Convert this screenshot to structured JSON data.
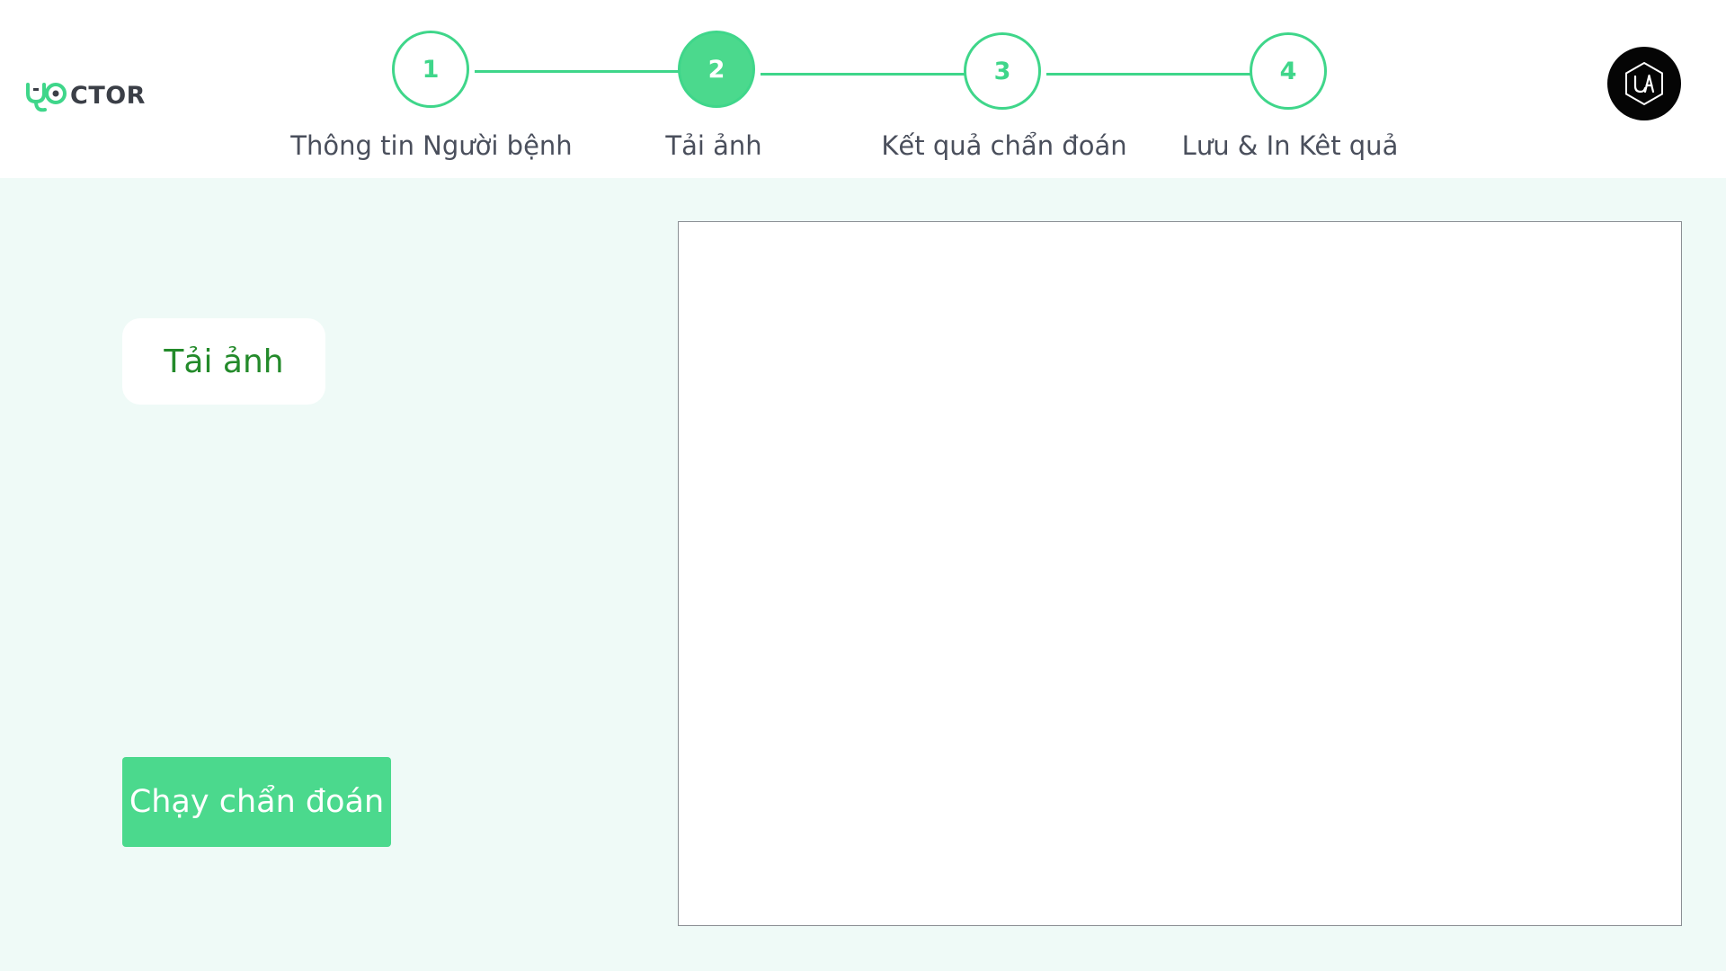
{
  "app": {
    "logo_text": "CTOR",
    "accent_color": "#4bd98d",
    "background_color": "#effaf7"
  },
  "stepper": {
    "steps": [
      {
        "number": "1",
        "label": "Thông tin Người bệnh",
        "state": "inactive"
      },
      {
        "number": "2",
        "label": "Tải ảnh",
        "state": "active"
      },
      {
        "number": "3",
        "label": "Kết quả chẩn đoán",
        "state": "inactive"
      },
      {
        "number": "4",
        "label": "Lưu & In Kêt quả",
        "state": "inactive"
      }
    ]
  },
  "user": {
    "avatar_icon": "ua-hexagon-icon"
  },
  "main": {
    "upload_label": "Tải ảnh",
    "run_label": "Chạy chẩn đoán"
  }
}
